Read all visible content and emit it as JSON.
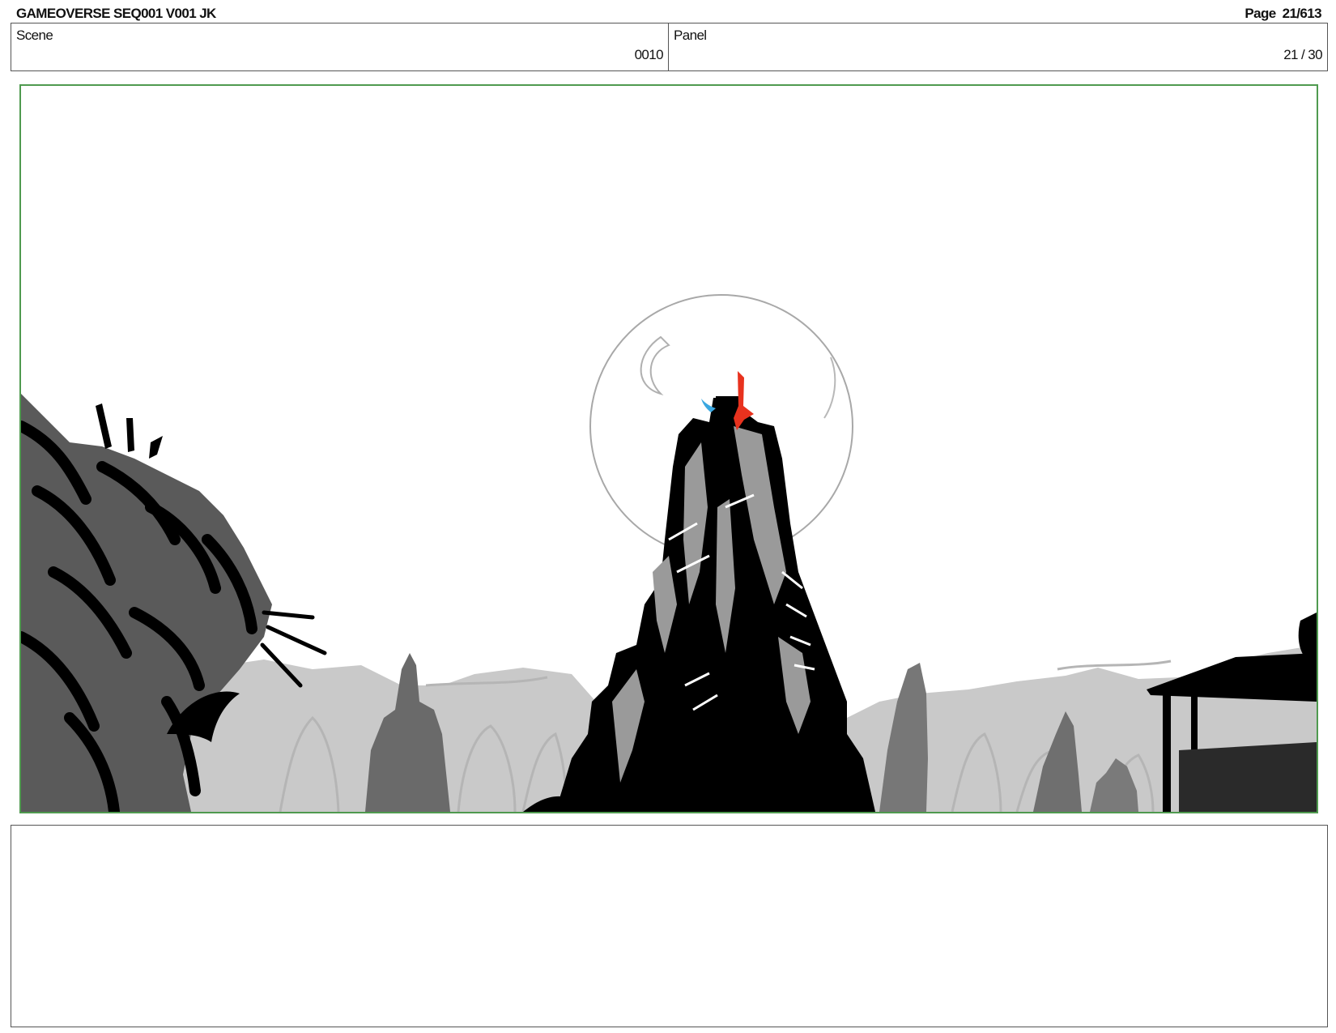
{
  "header": {
    "title": "GAMEOVERSE SEQ001 V001 JK",
    "page_label": "Page",
    "page_number": "21/613"
  },
  "info": {
    "scene_label": "Scene",
    "scene_value": "0010",
    "panel_label": "Panel",
    "panel_value": "21 / 30"
  },
  "colors": {
    "frame_border": "#4f9a4f",
    "flame": "#e8321e",
    "spark": "#3aa7e0"
  },
  "notes": {
    "dialogue": ""
  }
}
